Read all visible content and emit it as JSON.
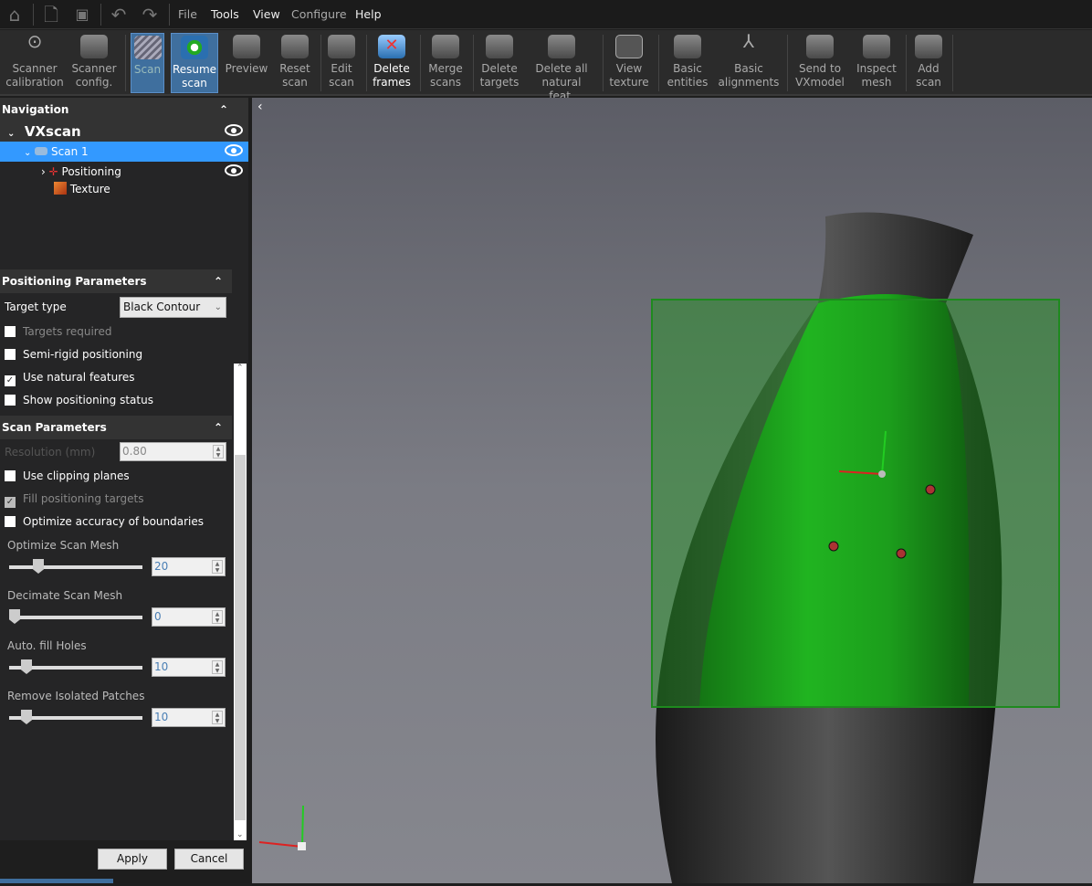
{
  "menubar": {
    "items": [
      "File",
      "Tools",
      "View",
      "Configure",
      "Help"
    ]
  },
  "toolbar": {
    "items": [
      {
        "label1": "Scanner",
        "label2": "calibration",
        "state": "normal"
      },
      {
        "label1": "Scanner",
        "label2": "config.",
        "state": "normal"
      },
      {
        "label1": "Scan",
        "label2": "",
        "state": "active-disabled"
      },
      {
        "label1": "Resume",
        "label2": "scan",
        "state": "active"
      },
      {
        "label1": "Preview",
        "label2": "",
        "state": "normal"
      },
      {
        "label1": "Reset",
        "label2": "scan",
        "state": "normal"
      },
      {
        "label1": "Edit",
        "label2": "scan",
        "state": "normal"
      },
      {
        "label1": "Delete",
        "label2": "frames",
        "state": "bright"
      },
      {
        "label1": "Merge",
        "label2": "scans",
        "state": "normal"
      },
      {
        "label1": "Delete",
        "label2": "targets",
        "state": "normal"
      },
      {
        "label1": "Delete all",
        "label2": "natural feat.",
        "state": "normal"
      },
      {
        "label1": "View",
        "label2": "texture",
        "state": "normal"
      },
      {
        "label1": "Basic",
        "label2": "entities",
        "state": "normal"
      },
      {
        "label1": "Basic",
        "label2": "alignments",
        "state": "normal"
      },
      {
        "label1": "Send to",
        "label2": "VXmodel",
        "state": "normal"
      },
      {
        "label1": "Inspect",
        "label2": "mesh",
        "state": "normal"
      },
      {
        "label1": "Add",
        "label2": "scan",
        "state": "normal"
      }
    ]
  },
  "navigation": {
    "title": "Navigation",
    "root": "VXscan",
    "scan": "Scan 1",
    "positioning": "Positioning",
    "texture": "Texture"
  },
  "positioning": {
    "title": "Positioning Parameters",
    "target_type_label": "Target type",
    "target_type_value": "Black Contour",
    "options": [
      {
        "label": "Targets required",
        "checked": false,
        "enabled": false
      },
      {
        "label": "Semi-rigid positioning",
        "checked": false,
        "enabled": true
      },
      {
        "label": "Use natural features",
        "checked": true,
        "enabled": true
      },
      {
        "label": "Show positioning status",
        "checked": false,
        "enabled": true
      }
    ]
  },
  "scan_params": {
    "title": "Scan Parameters",
    "resolution_label": "Resolution (mm)",
    "resolution_value": "0.80",
    "options": [
      {
        "label": "Use clipping planes",
        "checked": false,
        "enabled": true
      },
      {
        "label": "Fill positioning targets",
        "checked": true,
        "enabled": false
      },
      {
        "label": "Optimize accuracy of boundaries",
        "checked": false,
        "enabled": true
      }
    ],
    "sliders": [
      {
        "label": "Optimize Scan Mesh",
        "value": "20",
        "fraction": 0.2
      },
      {
        "label": "Decimate Scan Mesh",
        "value": "0",
        "fraction": 0
      },
      {
        "label": "Auto. fill Holes",
        "value": "10",
        "fraction": 0.1
      },
      {
        "label": "Remove Isolated Patches",
        "value": "10",
        "fraction": 0.1
      }
    ]
  },
  "buttons": {
    "apply": "Apply",
    "cancel": "Cancel"
  },
  "colors": {
    "selection": "#3399ff",
    "accent": "#3f6f9e",
    "scan_green": "#22cc22"
  }
}
